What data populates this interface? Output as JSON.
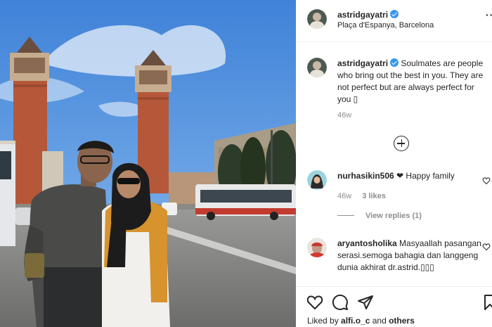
{
  "post": {
    "username": "astridgayatri",
    "location": "Plaça d'Espanya, Barcelona",
    "more_icon": "···",
    "caption": "Soulmates are people who bring out the best in you. They are not perfect but are always perfect for you ▯",
    "caption_time": "46w"
  },
  "comments": [
    {
      "username": "nurhasikin506",
      "text": "❤ Happy family",
      "time": "46w",
      "likes": "3 likes",
      "view_replies": "View replies (1)"
    },
    {
      "username": "aryantosholika",
      "text": "Masyaallah pasangan serasi.semoga bahagia dan langgeng dunia akhirat dr.astrid.▯▯▯"
    }
  ],
  "actions": {
    "liked_prefix": "Liked by ",
    "liked_user": "alfi.o_c",
    "liked_mid": " and ",
    "liked_others": "others"
  },
  "icons": {
    "verified": "verified-badge-icon",
    "more": "more-options-icon",
    "load_more": "plus-circle-icon",
    "like": "heart-icon",
    "comment": "comment-icon",
    "share": "paper-plane-icon",
    "save": "bookmark-icon"
  },
  "colors": {
    "verified_blue": "#3897f0",
    "secondary_text": "#8e8e8e",
    "primary_text": "#262626"
  }
}
